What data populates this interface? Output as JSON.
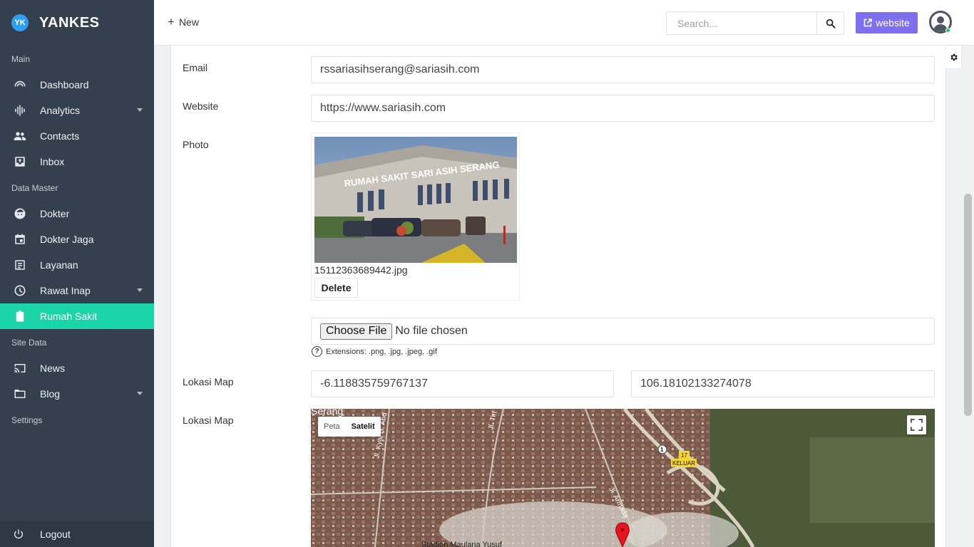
{
  "sidebar": {
    "brand_logo": "YK",
    "brand_name": "YANKES",
    "sections": {
      "main": "Main",
      "data_master": "Data Master",
      "site_data": "Site Data",
      "settings": "Settings"
    },
    "items": {
      "dashboard": "Dashboard",
      "analytics": "Analytics",
      "contacts": "Contacts",
      "inbox": "Inbox",
      "dokter": "Dokter",
      "dokter_jaga": "Dokter Jaga",
      "layanan": "Layanan",
      "rawat_inap": "Rawat Inap",
      "rumah_sakit": "Rumah Sakit",
      "news": "News",
      "blog": "Blog"
    },
    "logout": "Logout",
    "active_color": "#1bd4a8",
    "bg_color": "#34404e"
  },
  "topbar": {
    "new_label": "New",
    "search_placeholder": "Search...",
    "website_label": "website",
    "website_color": "#7e6ff0"
  },
  "form": {
    "email_label": "Email",
    "email_value": "rssariasihserang@sariasih.com",
    "website_label": "Website",
    "website_value": "https://www.sariasih.com",
    "photo_label": "Photo",
    "photo_sign": "RUMAH SAKIT  SARI  ASIH SERANG",
    "photo_filename": "15112363689442.jpg",
    "delete_label": "Delete",
    "choose_file_label": "Choose File",
    "no_file_text": "No file chosen",
    "extensions_help": "Extensions: .png, .jpg, .jpeg, .gif",
    "lokasi_label": "Lokasi Map",
    "latitude": "-6.118835759767137",
    "longitude": "106.18102133274078",
    "map_label": "Lokasi Map"
  },
  "map": {
    "type_peta": "Peta",
    "type_satelit": "Satelit",
    "selected_type": "Satelit",
    "road_kyai": "Jl. Kyai H. Abd",
    "road_tirt": "Jl. Tirt",
    "road_armada": "Jl. Armada",
    "place_serang": "Serang",
    "place_stadion": "Stadion Maulana Yusuf",
    "route_shield": "1",
    "exit_number": "17",
    "exit_label": "KELUAR"
  }
}
